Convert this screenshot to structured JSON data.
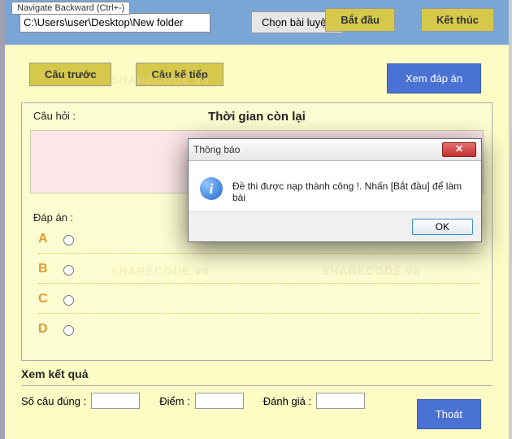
{
  "tooltip": "Navigate Backward (Ctrl+-)",
  "path_value": "C:\\Users\\user\\Desktop\\New folder",
  "buttons": {
    "choose": "Chọn bài luyện",
    "start": "Bắt đầu",
    "end": "Kết thúc",
    "prev": "Câu trước",
    "next": "Câu kế tiếp",
    "show_answer": "Xem đáp án",
    "exit": "Thoát"
  },
  "question": {
    "label": "Câu hỏi :",
    "timer_label": "Thời gian còn lại"
  },
  "answers": {
    "label": "Đáp án :",
    "letters": [
      "A",
      "B",
      "C",
      "D"
    ]
  },
  "results": {
    "title": "Xem kết quả",
    "correct": "Số câu đúng :",
    "score": "Điểm :",
    "grade": "Đánh giá :"
  },
  "modal": {
    "title": "Thông báo",
    "message": "Đề thi được nạp thành công !. Nhấn [Bắt đầu] để làm bài",
    "ok": "OK"
  },
  "watermark": "SHARECODE.vn"
}
